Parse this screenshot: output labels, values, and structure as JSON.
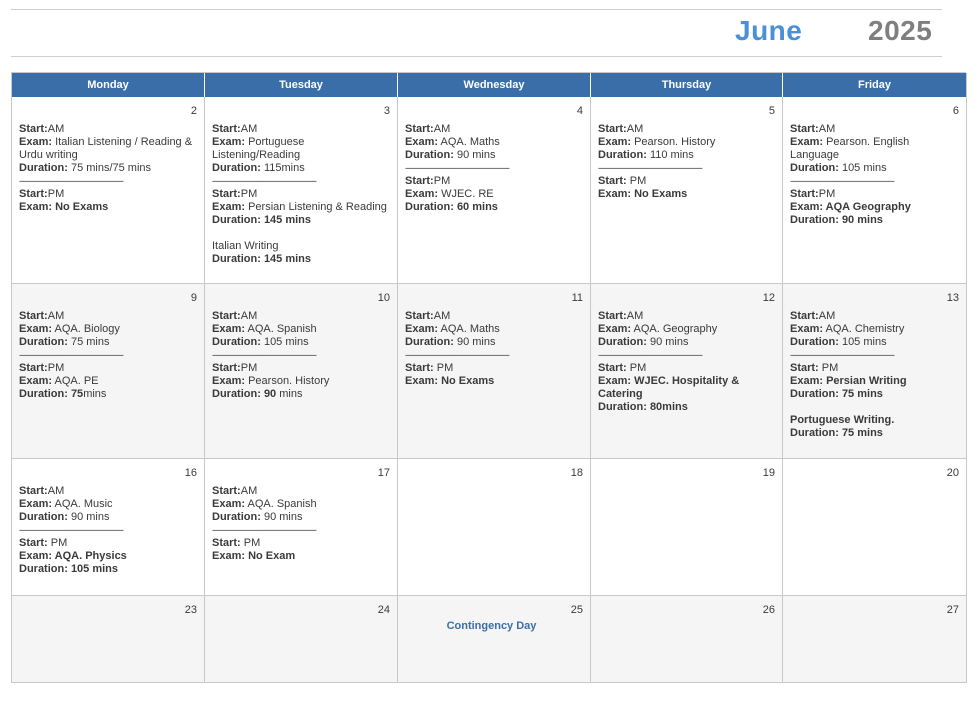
{
  "header": {
    "month": "June",
    "year": "2025"
  },
  "weekdays": [
    "Monday",
    "Tuesday",
    "Wednesday",
    "Thursday",
    "Friday"
  ],
  "weeks": [
    {
      "height": 187,
      "days": [
        {
          "num": "2",
          "lines": [
            {
              "k": "Start:",
              "v": "AM"
            },
            {
              "k": "Exam:",
              "v": " Italian Listening / Reading & Urdu writing"
            },
            {
              "k": "Duration:",
              "v": " 75 mins/75 mins"
            },
            {
              "sep": true
            },
            {
              "k": "Start:",
              "v": "PM"
            },
            {
              "k": "Exam: No Exams",
              "v": ""
            }
          ]
        },
        {
          "num": "3",
          "lines": [
            {
              "k": "Start:",
              "v": "AM"
            },
            {
              "k": "Exam:",
              "v": " Portuguese Listening/Reading"
            },
            {
              "k": "Duration:",
              "v": " 115mins"
            },
            {
              "sep": true
            },
            {
              "k": "Start:",
              "v": "PM"
            },
            {
              "k": "Exam:",
              "v": " Persian Listening & Reading"
            },
            {
              "k": "Duration: 145 mins",
              "v": ""
            },
            {
              "gap": true
            },
            {
              "k": "",
              "v": "Italian Writing"
            },
            {
              "k": "Duration: 145 mins",
              "v": ""
            }
          ]
        },
        {
          "num": "4",
          "lines": [
            {
              "k": "Start:",
              "v": "AM"
            },
            {
              "k": "Exam:",
              "v": " AQA. Maths"
            },
            {
              "k": "Duration:",
              "v": " 90 mins"
            },
            {
              "sep": true
            },
            {
              "k": "Start:",
              "v": "PM"
            },
            {
              "k": "Exam:",
              "v": " WJEC. RE"
            },
            {
              "k": "Duration: 60 mins",
              "v": ""
            }
          ]
        },
        {
          "num": "5",
          "lines": [
            {
              "k": "Start:",
              "v": "AM"
            },
            {
              "k": "Exam:",
              "v": " Pearson. History"
            },
            {
              "k": "Duration:",
              "v": " 110 mins"
            },
            {
              "sep": true
            },
            {
              "k": "Start:",
              "v": " PM"
            },
            {
              "k": "Exam: No Exams",
              "v": ""
            }
          ]
        },
        {
          "num": "6",
          "lines": [
            {
              "k": "Start:",
              "v": "AM"
            },
            {
              "k": "Exam:",
              "v": " Pearson. English Language"
            },
            {
              "k": "Duration:",
              "v": " 105 mins"
            },
            {
              "sep": true
            },
            {
              "k": "Start:",
              "v": "PM"
            },
            {
              "k": "Exam: AQA Geography",
              "v": ""
            },
            {
              "k": "Duration: 90 mins",
              "v": ""
            }
          ]
        }
      ]
    },
    {
      "height": 175,
      "shade": true,
      "days": [
        {
          "num": "9",
          "lines": [
            {
              "k": "Start:",
              "v": "AM"
            },
            {
              "k": "Exam:",
              "v": " AQA. Biology"
            },
            {
              "k": "Duration:",
              "v": " 75 mins"
            },
            {
              "sep": true
            },
            {
              "k": "Start:",
              "v": "PM"
            },
            {
              "k": "Exam:",
              "v": " AQA. PE"
            },
            {
              "k": "Duration: 75",
              "v": "mins"
            }
          ]
        },
        {
          "num": "10",
          "lines": [
            {
              "k": "Start:",
              "v": "AM"
            },
            {
              "k": "Exam:",
              "v": " AQA. Spanish"
            },
            {
              "k": "Duration:",
              "v": " 105 mins"
            },
            {
              "sep": true
            },
            {
              "k": "Start:",
              "v": "PM"
            },
            {
              "k": "Exam:",
              "v": " Pearson. History"
            },
            {
              "k": "Duration: 90",
              "v": " mins"
            }
          ]
        },
        {
          "num": "11",
          "lines": [
            {
              "k": "Start:",
              "v": "AM"
            },
            {
              "k": "Exam:",
              "v": " AQA. Maths"
            },
            {
              "k": "Duration:",
              "v": " 90 mins"
            },
            {
              "sep": true
            },
            {
              "k": "Start:",
              "v": " PM"
            },
            {
              "k": "Exam: No Exams",
              "v": ""
            }
          ]
        },
        {
          "num": "12",
          "lines": [
            {
              "k": "Start:",
              "v": "AM"
            },
            {
              "k": "Exam:",
              "v": " AQA. Geography"
            },
            {
              "k": "Duration:",
              "v": " 90 mins"
            },
            {
              "sep": true
            },
            {
              "k": "Start:",
              "v": " PM"
            },
            {
              "k": "Exam: WJEC. Hospitality & Catering",
              "v": ""
            },
            {
              "k": "Duration: 80mins",
              "v": ""
            }
          ]
        },
        {
          "num": "13",
          "lines": [
            {
              "k": "Start:",
              "v": "AM"
            },
            {
              "k": "Exam:",
              "v": " AQA. Chemistry"
            },
            {
              "k": "Duration:",
              "v": " 105 mins"
            },
            {
              "sep": true
            },
            {
              "k": "Start:",
              "v": " PM"
            },
            {
              "k": "Exam: Persian Writing",
              "v": ""
            },
            {
              "k": "Duration: 75 mins",
              "v": ""
            },
            {
              "gap": true
            },
            {
              "k": "Portuguese Writing.",
              "v": ""
            },
            {
              "k": "Duration: 75 mins",
              "v": ""
            }
          ]
        }
      ]
    },
    {
      "height": 137,
      "days": [
        {
          "num": "16",
          "lines": [
            {
              "k": "Start:",
              "v": "AM"
            },
            {
              "k": "Exam:",
              "v": " AQA. Music"
            },
            {
              "k": "Duration:",
              "v": " 90 mins"
            },
            {
              "sep": true
            },
            {
              "k": "Start:",
              "v": " PM"
            },
            {
              "k": "Exam: AQA. Physics",
              "v": ""
            },
            {
              "k": "Duration: 105 mins",
              "v": ""
            }
          ]
        },
        {
          "num": "17",
          "lines": [
            {
              "k": "Start:",
              "v": "AM"
            },
            {
              "k": "Exam:",
              "v": " AQA. Spanish"
            },
            {
              "k": "Duration:",
              "v": " 90 mins"
            },
            {
              "sep": true
            },
            {
              "k": "Start:",
              "v": " PM"
            },
            {
              "k": "Exam: No Exam",
              "v": ""
            }
          ]
        },
        {
          "num": "18",
          "lines": []
        },
        {
          "num": "19",
          "lines": []
        },
        {
          "num": "20",
          "lines": []
        }
      ]
    },
    {
      "height": 87,
      "shade": true,
      "days": [
        {
          "num": "23",
          "lines": []
        },
        {
          "num": "24",
          "lines": []
        },
        {
          "num": "25",
          "lines": [],
          "special": "Contingency Day"
        },
        {
          "num": "26",
          "lines": []
        },
        {
          "num": "27",
          "lines": []
        }
      ]
    }
  ],
  "separator": "----------------------------------------------------"
}
